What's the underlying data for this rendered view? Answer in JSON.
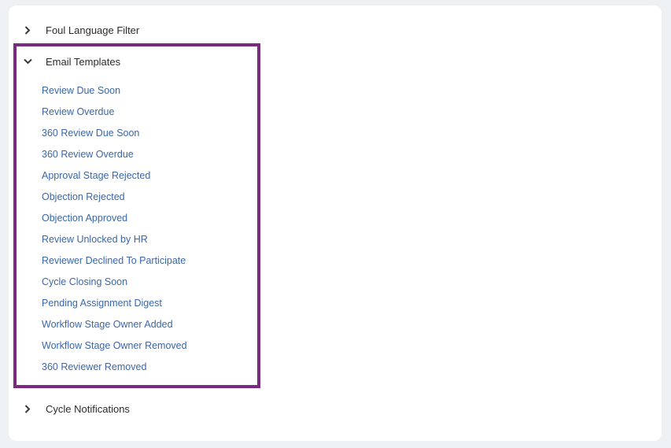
{
  "sections": {
    "foul_language": {
      "label": "Foul Language Filter",
      "icon": "chevron-right-icon"
    },
    "email_templates": {
      "label": "Email Templates",
      "icon": "chevron-down-icon",
      "items": [
        "Review Due Soon",
        "Review Overdue",
        "360 Review Due Soon",
        "360 Review Overdue",
        "Approval Stage Rejected",
        "Objection Rejected",
        "Objection Approved",
        "Review Unlocked by HR",
        "Reviewer Declined To Participate",
        "Cycle Closing Soon",
        "Pending Assignment Digest",
        "Workflow Stage Owner Added",
        "Workflow Stage Owner Removed",
        "360 Reviewer Removed"
      ]
    },
    "cycle_notifications": {
      "label": "Cycle Notifications",
      "icon": "chevron-right-icon"
    }
  },
  "colors": {
    "highlight_border": "#7a2a80",
    "link": "#3b66a8",
    "background": "#eef1f4"
  }
}
